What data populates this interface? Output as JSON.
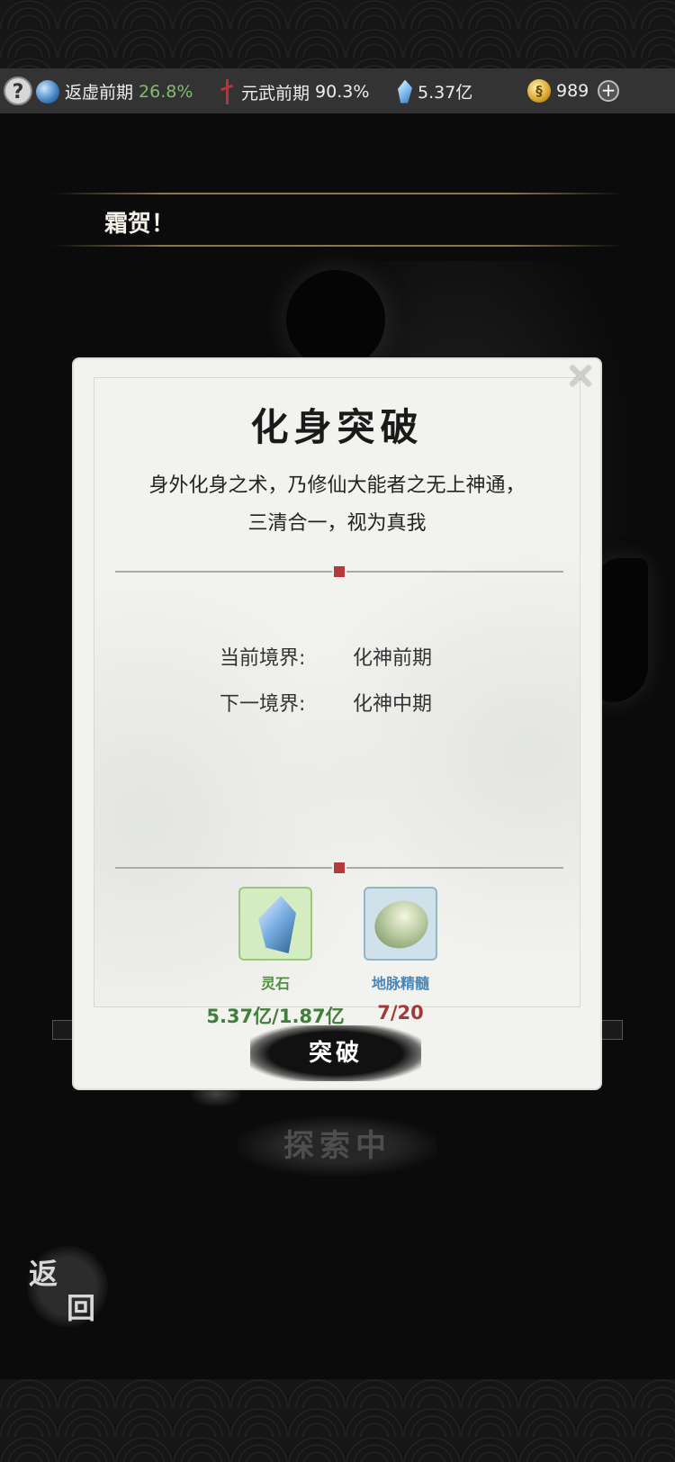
{
  "status_bar": {
    "help": "?",
    "realm1": {
      "label": "返虚前期",
      "percent": "26.8%"
    },
    "realm2": {
      "label": "元武前期",
      "percent": "90.3%"
    },
    "spirit_stone": "5.37亿",
    "coins": "989",
    "plus": "+"
  },
  "banner": {
    "text": "霜贺！"
  },
  "modal": {
    "title": "化身突破",
    "desc_line1": "身外化身之术，乃修仙大能者之无上神通，",
    "desc_line2": "三清合一，视为真我",
    "current_label": "当前境界:",
    "current_value": "化神前期",
    "next_label": "下一境界:",
    "next_value": "化神中期",
    "items": [
      {
        "name": "灵石",
        "count": "5.37亿/1.87亿",
        "color": "#3f7f3a"
      },
      {
        "name": "地脉精髓",
        "count": "7/20",
        "color": "#a33a3a"
      }
    ],
    "item_name_colors": [
      "#4f8f3f",
      "#4a86b5"
    ],
    "button": "突破",
    "close": "✕"
  },
  "explore_button": "探索中",
  "back_button": {
    "char1": "返",
    "char2": "回"
  }
}
